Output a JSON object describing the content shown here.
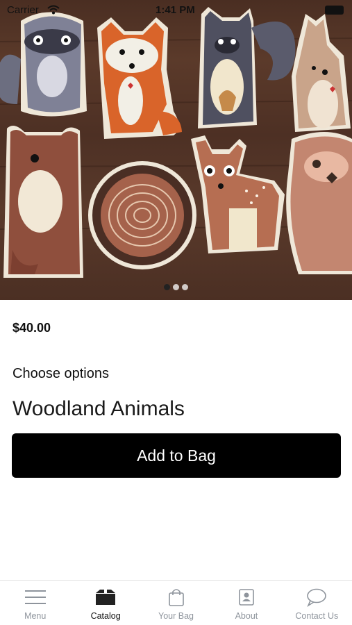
{
  "status_bar": {
    "carrier": "Carrier",
    "time": "1:41 PM"
  },
  "product": {
    "price": "$40.00",
    "choose_options_label": "Choose options",
    "selected_option": "Woodland Animals",
    "add_to_bag_label": "Add to Bag"
  },
  "carousel": {
    "count": 3,
    "active_index": 0
  },
  "tabs": [
    {
      "label": "Menu",
      "icon": "menu-icon",
      "active": false
    },
    {
      "label": "Catalog",
      "icon": "box-icon",
      "active": true
    },
    {
      "label": "Your Bag",
      "icon": "bag-icon",
      "active": false
    },
    {
      "label": "About",
      "icon": "contact-card-icon",
      "active": false
    },
    {
      "label": "Contact Us",
      "icon": "chat-bubble-icon",
      "active": false
    }
  ],
  "colors": {
    "primary_button": "#000000",
    "tab_inactive": "#8e949c",
    "tab_active": "#111111"
  }
}
